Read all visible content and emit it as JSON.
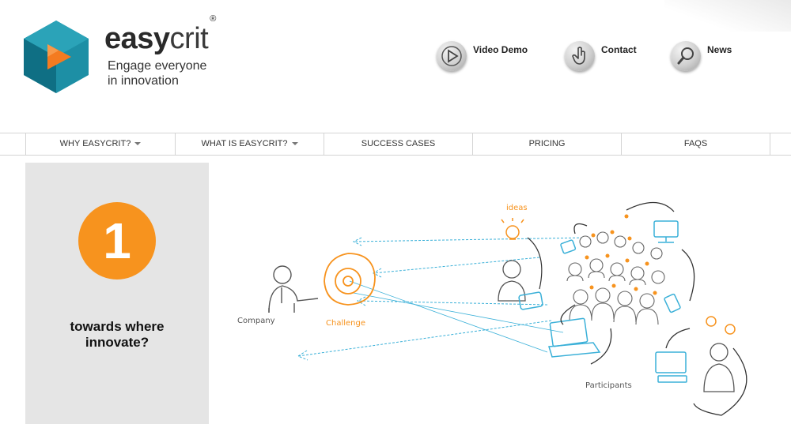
{
  "brand": {
    "name_part1": "easy",
    "name_part2": "crit",
    "registered": "®",
    "tagline_line1": "Engage everyone",
    "tagline_line2": "in innovation",
    "colors": {
      "teal": "#1d8fa5",
      "dark_teal": "#0d5e72",
      "orange": "#f47b20"
    }
  },
  "topnav": [
    {
      "label": "Video Demo",
      "icon": "play-icon"
    },
    {
      "label": "Contact",
      "icon": "pointer-hand-icon"
    },
    {
      "label": "News",
      "icon": "magnifier-icon"
    }
  ],
  "mainnav": [
    {
      "label": "WHY EASYCRIT?",
      "dropdown": true
    },
    {
      "label": "WHAT IS EASYCRIT?",
      "dropdown": true
    },
    {
      "label": "SUCCESS CASES",
      "dropdown": false
    },
    {
      "label": "PRICING",
      "dropdown": false
    },
    {
      "label": "FAQS",
      "dropdown": false
    }
  ],
  "step": {
    "number": "1",
    "text_line1": "towards where",
    "text_line2": "innovate?",
    "accent": "#f7931e"
  },
  "illustration": {
    "labels": {
      "company": "Company",
      "challenge": "Challenge",
      "ideas": "ideas",
      "participants": "Participants"
    },
    "colors": {
      "orange": "#f7931e",
      "blue": "#3ab0d8",
      "ink": "#555555"
    }
  }
}
